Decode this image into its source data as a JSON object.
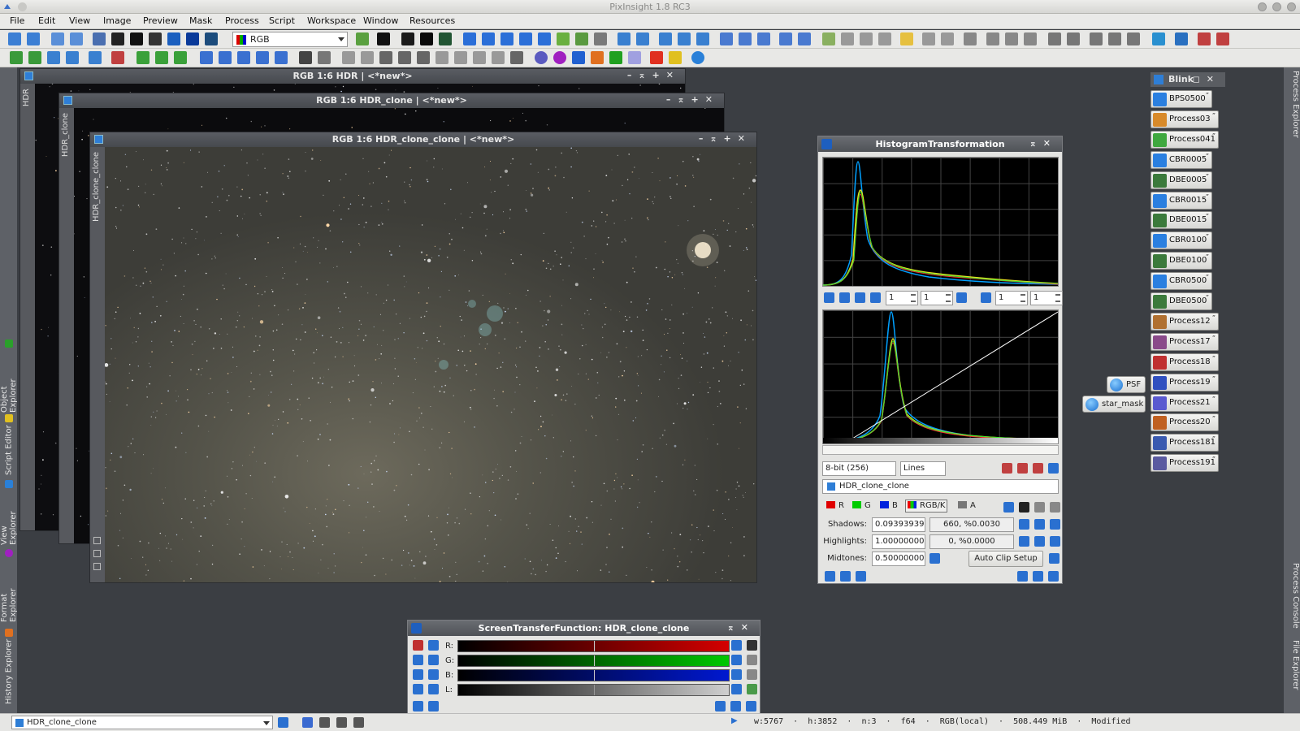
{
  "app": {
    "title": "PixInsight 1.8 RC3"
  },
  "menu": [
    "File",
    "Edit",
    "View",
    "Image",
    "Preview",
    "Mask",
    "Process",
    "Script",
    "Workspace",
    "Window",
    "Resources"
  ],
  "toolbar": {
    "color_space": "RGB"
  },
  "left_tabs": [
    "Object Explorer",
    "Script Editor",
    "View Explorer",
    "Format Explorer",
    "History Explorer"
  ],
  "right_tabs": [
    "Process Explorer",
    "Process Console",
    "File Explorer"
  ],
  "windows": [
    {
      "title": "RGB 1:6 HDR | <*new*>",
      "id": "HDR"
    },
    {
      "title": "RGB 1:6 HDR_clone | <*new*>",
      "id": "HDR_clone"
    },
    {
      "title": "RGB 1:6 HDR_clone_clone | <*new*>",
      "id": "HDR_clone_clone"
    }
  ],
  "histogram": {
    "title": "HistogramTransformation",
    "zoom_values": [
      "1",
      "1",
      "1",
      "1"
    ],
    "resolution": "8-bit (256)",
    "plot_mode": "Lines",
    "view": "HDR_clone_clone",
    "channels": [
      {
        "label": "R",
        "color": "#e00000"
      },
      {
        "label": "G",
        "color": "#00cc00"
      },
      {
        "label": "B",
        "color": "#0022dd"
      },
      {
        "label": "RGB/K",
        "color": "#444444"
      },
      {
        "label": "A",
        "color": "#777777"
      }
    ],
    "shadows_label": "Shadows:",
    "shadows": "0.09393939",
    "shadows_clip": "660, %0.0030",
    "highlights_label": "Highlights:",
    "highlights": "1.00000000",
    "highlights_clip": "0, %0.0000",
    "midtones_label": "Midtones:",
    "midtones": "0.50000000",
    "auto_clip": "Auto Clip Setup"
  },
  "stf": {
    "title": "ScreenTransferFunction: HDR_clone_clone",
    "channels": [
      {
        "label": "R:",
        "color": "#d40000"
      },
      {
        "label": "G:",
        "color": "#00c800"
      },
      {
        "label": "B:",
        "color": "#0018d0"
      },
      {
        "label": "L:",
        "color": "#cfcfcf"
      }
    ]
  },
  "blink": {
    "title": "Blink"
  },
  "process_icons": [
    {
      "label": "BPS0500",
      "icon": "#2a7fe0"
    },
    {
      "label": "Process03",
      "icon": "#d88a2a"
    },
    {
      "label": "Process041",
      "icon": "#3fa83f"
    },
    {
      "label": "CBR0005",
      "icon": "#2a7fe0"
    },
    {
      "label": "DBE0005",
      "icon": "#3b7a3b"
    },
    {
      "label": "CBR0015",
      "icon": "#2a7fe0"
    },
    {
      "label": "DBE0015",
      "icon": "#3b7a3b"
    },
    {
      "label": "CBR0100",
      "icon": "#2a7fe0"
    },
    {
      "label": "DBE0100",
      "icon": "#3b7a3b"
    },
    {
      "label": "CBR0500",
      "icon": "#2a7fe0"
    },
    {
      "label": "DBE0500",
      "icon": "#3b7a3b"
    },
    {
      "label": "Process12",
      "icon": "#b07030"
    },
    {
      "label": "Process17",
      "icon": "#8a4a8a"
    },
    {
      "label": "Process18",
      "icon": "#c03030"
    },
    {
      "label": "Process19",
      "icon": "#3050c0"
    },
    {
      "label": "Process21",
      "icon": "#5a5ad0"
    },
    {
      "label": "Process20",
      "icon": "#c06020"
    },
    {
      "label": "Process181",
      "icon": "#3a5ab0"
    },
    {
      "label": "Process191",
      "icon": "#5a5aa0"
    }
  ],
  "floating_icons": [
    {
      "label": "PSF"
    },
    {
      "label": "star_mask"
    }
  ],
  "status": {
    "view": "HDR_clone_clone",
    "info": "w:5767  ·  h:3852  ·  n:3  ·  f64  ·  RGB(local)  ·  508.449 MiB  ·  Modified"
  }
}
